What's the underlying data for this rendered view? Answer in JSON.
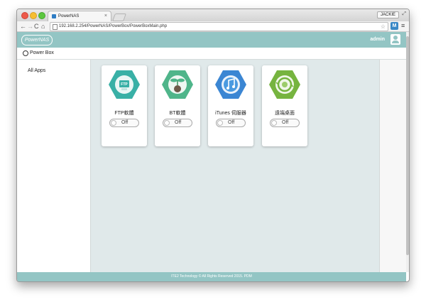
{
  "browser": {
    "tab_title": "PowerNAS",
    "tab_close": "×",
    "user_badge": "JACKIE",
    "url": "192.168.2.254/PowerNAS/PowerBox/PowerBoxMain.php",
    "extension_label": "M"
  },
  "header": {
    "logo": "PowerNAS",
    "username": "admin"
  },
  "subheader": {
    "title": "Power Box"
  },
  "sidebar": {
    "items": [
      {
        "label": "All Apps"
      }
    ]
  },
  "apps": [
    {
      "name": "FTP軟體",
      "toggle": "Off",
      "icon": "ftp-icon",
      "color": "#39b0a6"
    },
    {
      "name": "BT軟體",
      "toggle": "Off",
      "icon": "bt-sprout-icon",
      "color": "#4fb58a"
    },
    {
      "name": "iTunes 伺服器",
      "toggle": "Off",
      "icon": "itunes-icon",
      "color": "#3b86d3"
    },
    {
      "name": "遠端桌面",
      "toggle": "Off",
      "icon": "remote-desktop-icon",
      "color": "#76b43f"
    }
  ],
  "footer": {
    "text": "ITE2 Technology © All Rights Reserved 2015. PDM"
  },
  "colors": {
    "accent": "#93c5c4",
    "content_bg": "#e0e9ea"
  }
}
